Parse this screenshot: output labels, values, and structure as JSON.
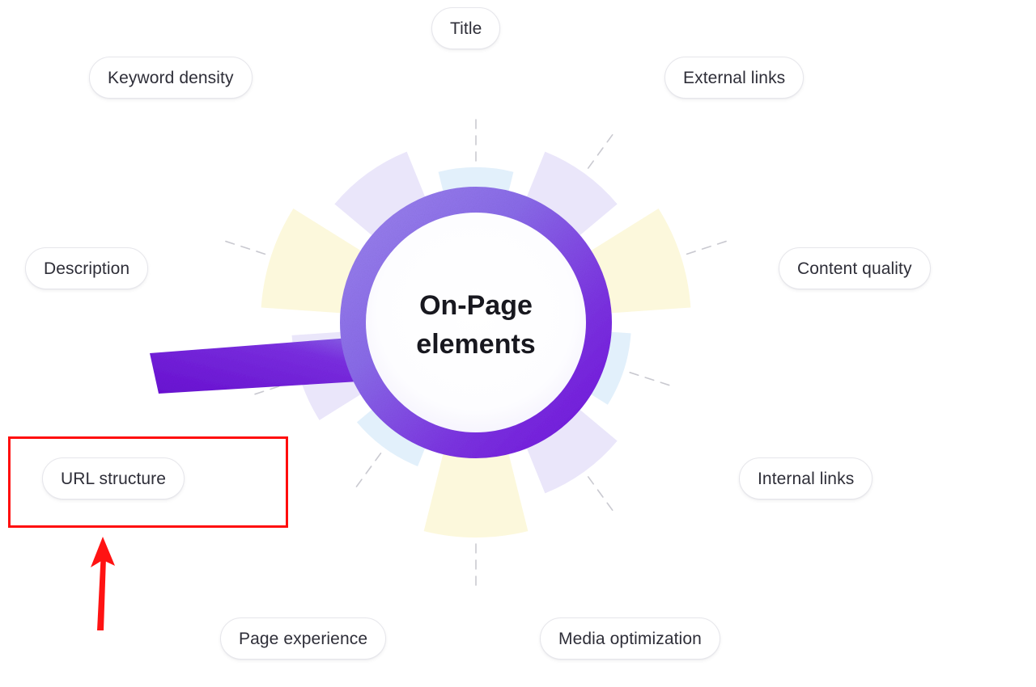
{
  "diagram": {
    "center_title_line1": "On-Page",
    "center_title_line2": "elements",
    "center_title": "On-Page elements",
    "type": "radial-petal-wheel",
    "petal_count": 10,
    "colors": {
      "background": "#FFFFFF",
      "petal_yellow": "#FCF8DC",
      "petal_blue": "#E2F0FB",
      "petal_lavender": "#EAE6FA",
      "ring_gradient_start": "#8E74EA",
      "ring_gradient_end": "#7A1FE0",
      "handle_start": "#8E74EA",
      "handle_end": "#6E12D6",
      "label_text": "#2E2E38",
      "label_border": "#E6E6EB",
      "connector_line": "#C9C9D0",
      "center_text": "#18181F",
      "annotation_red": "#FF0D0D"
    },
    "labels": [
      {
        "id": "title",
        "text": "Title",
        "petal_color": "petal_blue",
        "angle_deg": -90,
        "petal_length": "short"
      },
      {
        "id": "external-links",
        "text": "External links",
        "petal_color": "petal_lavender",
        "angle_deg": -54,
        "petal_length": "medium"
      },
      {
        "id": "content-quality",
        "text": "Content quality",
        "petal_color": "petal_yellow",
        "angle_deg": -18,
        "petal_length": "long"
      },
      {
        "id": "internal-links",
        "text": "Internal links",
        "petal_color": "petal_blue",
        "angle_deg": 18,
        "petal_length": "short"
      },
      {
        "id": "media-optimization",
        "text": "Media optimization",
        "petal_color": "petal_lavender",
        "angle_deg": 54,
        "petal_length": "medium"
      },
      {
        "id": "page-experience",
        "text": "Page experience",
        "petal_color": "petal_yellow",
        "angle_deg": 90,
        "petal_length": "long"
      },
      {
        "id": "url-structure",
        "text": "URL structure",
        "petal_color": "petal_blue",
        "angle_deg": 126,
        "petal_length": "short"
      },
      {
        "id": "description",
        "text": "Description",
        "petal_color": "petal_lavender",
        "angle_deg": 162,
        "petal_length": "medium"
      },
      {
        "id": "keyword-density",
        "text": "Keyword density",
        "petal_color": "petal_yellow",
        "angle_deg": 198,
        "petal_length": "long"
      },
      {
        "id": "spare-lavender",
        "text": "",
        "petal_color": "petal_lavender",
        "angle_deg": 234,
        "petal_length": "medium"
      }
    ]
  },
  "annotation": {
    "highlight_target": "URL structure",
    "box_label": "red-highlight-box",
    "arrow_label": "red-pointer-arrow"
  }
}
